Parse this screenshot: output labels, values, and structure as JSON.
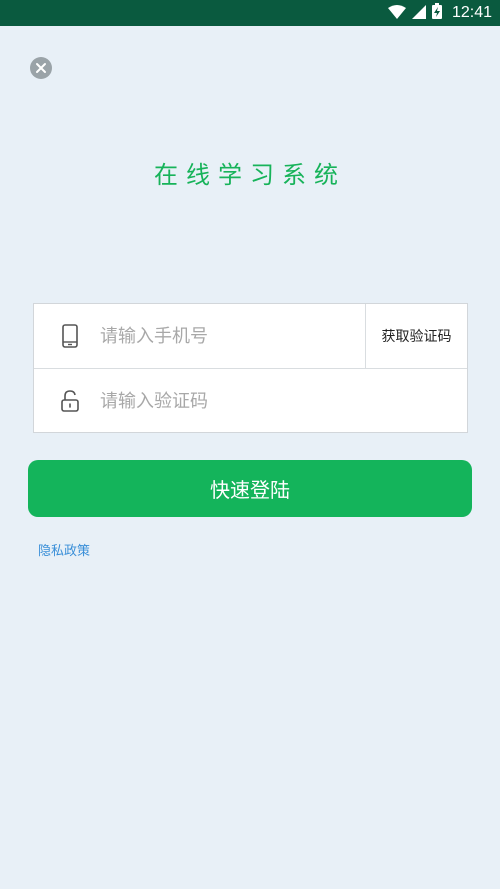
{
  "status_bar": {
    "time": "12:41",
    "icons": [
      "wifi-icon",
      "signal-icon",
      "battery-charging-icon"
    ],
    "background": "#0a5a3f"
  },
  "header": {
    "close_icon": "close-icon"
  },
  "title": "在线学习系统",
  "form": {
    "phone": {
      "icon": "phone-icon",
      "placeholder": "请输入手机号",
      "value": ""
    },
    "get_code_label": "获取验证码",
    "code": {
      "icon": "lock-icon",
      "placeholder": "请输入验证码",
      "value": ""
    }
  },
  "login_button_label": "快速登陆",
  "privacy_link_label": "隐私政策",
  "colors": {
    "accent": "#14b45b",
    "title": "#17b35a",
    "link": "#3a8fd8",
    "background": "#e8f0f7"
  }
}
